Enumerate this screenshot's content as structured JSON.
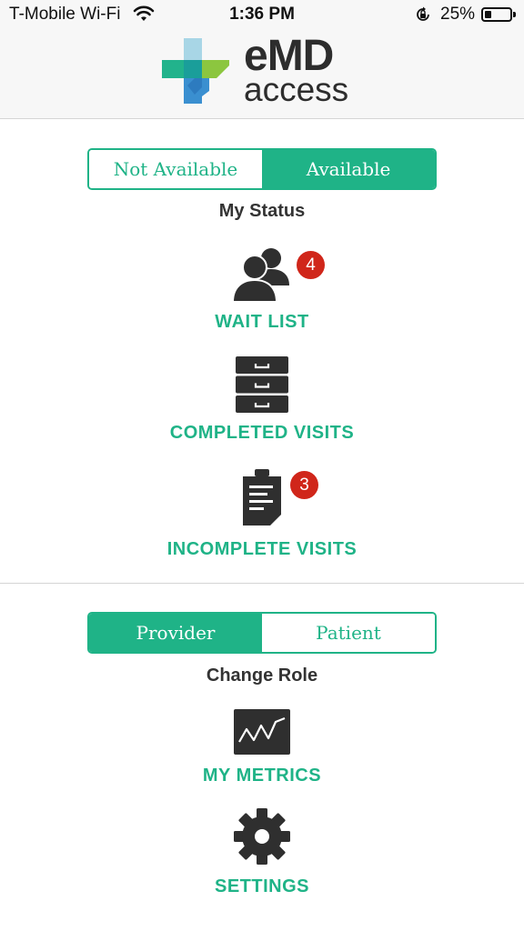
{
  "status_bar": {
    "carrier": "T-Mobile Wi-Fi",
    "time": "1:36 PM",
    "battery": "25%"
  },
  "header": {
    "logo_line1": "eMD",
    "logo_line2": "access"
  },
  "status_toggle": {
    "options": [
      "Not Available",
      "Available"
    ],
    "selected": "Available",
    "caption": "My Status"
  },
  "menu_top": [
    {
      "label": "WAIT LIST",
      "icon": "users-icon",
      "badge": "4"
    },
    {
      "label": "COMPLETED VISITS",
      "icon": "filing-cabinet-icon"
    },
    {
      "label": "INCOMPLETE VISITS",
      "icon": "clipboard-icon",
      "badge": "3"
    }
  ],
  "role_toggle": {
    "options": [
      "Provider",
      "Patient"
    ],
    "selected": "Provider",
    "caption": "Change Role"
  },
  "menu_bottom": [
    {
      "label": "MY METRICS",
      "icon": "chart-icon"
    },
    {
      "label": "SETTINGS",
      "icon": "gear-icon"
    }
  ],
  "colors": {
    "accent": "#1fb387",
    "badge": "#d0261a",
    "icon": "#2f2f2f"
  }
}
